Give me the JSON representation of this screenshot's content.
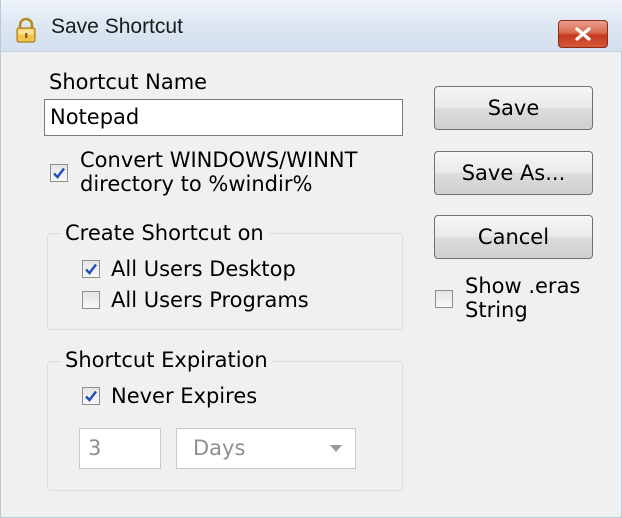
{
  "window": {
    "title": "Save Shortcut",
    "close_icon": "close-x-icon",
    "title_icon": "lock-icon"
  },
  "shortcut_name": {
    "label": "Shortcut Name",
    "value": "Notepad"
  },
  "convert_option": {
    "line1": "Convert WINDOWS/WINNT",
    "line2": "directory to %windir%",
    "checked": true
  },
  "create_group": {
    "title": "Create Shortcut on",
    "items": [
      {
        "label": "All Users Desktop",
        "checked": true
      },
      {
        "label": "All Users Programs",
        "checked": false
      }
    ]
  },
  "expiration_group": {
    "title": "Shortcut Expiration",
    "never_expires": {
      "label": "Never Expires",
      "checked": true
    },
    "count_value": "3",
    "unit_value": "Days"
  },
  "buttons": {
    "save": "Save",
    "save_as": "Save As...",
    "cancel": "Cancel"
  },
  "show_eras": {
    "line1": "Show .eras",
    "line2": "String",
    "checked": false
  },
  "colors": {
    "check_blue": "#1d4fb8",
    "close_red": "#c4391c",
    "window_bg": "#f0f0f0"
  }
}
